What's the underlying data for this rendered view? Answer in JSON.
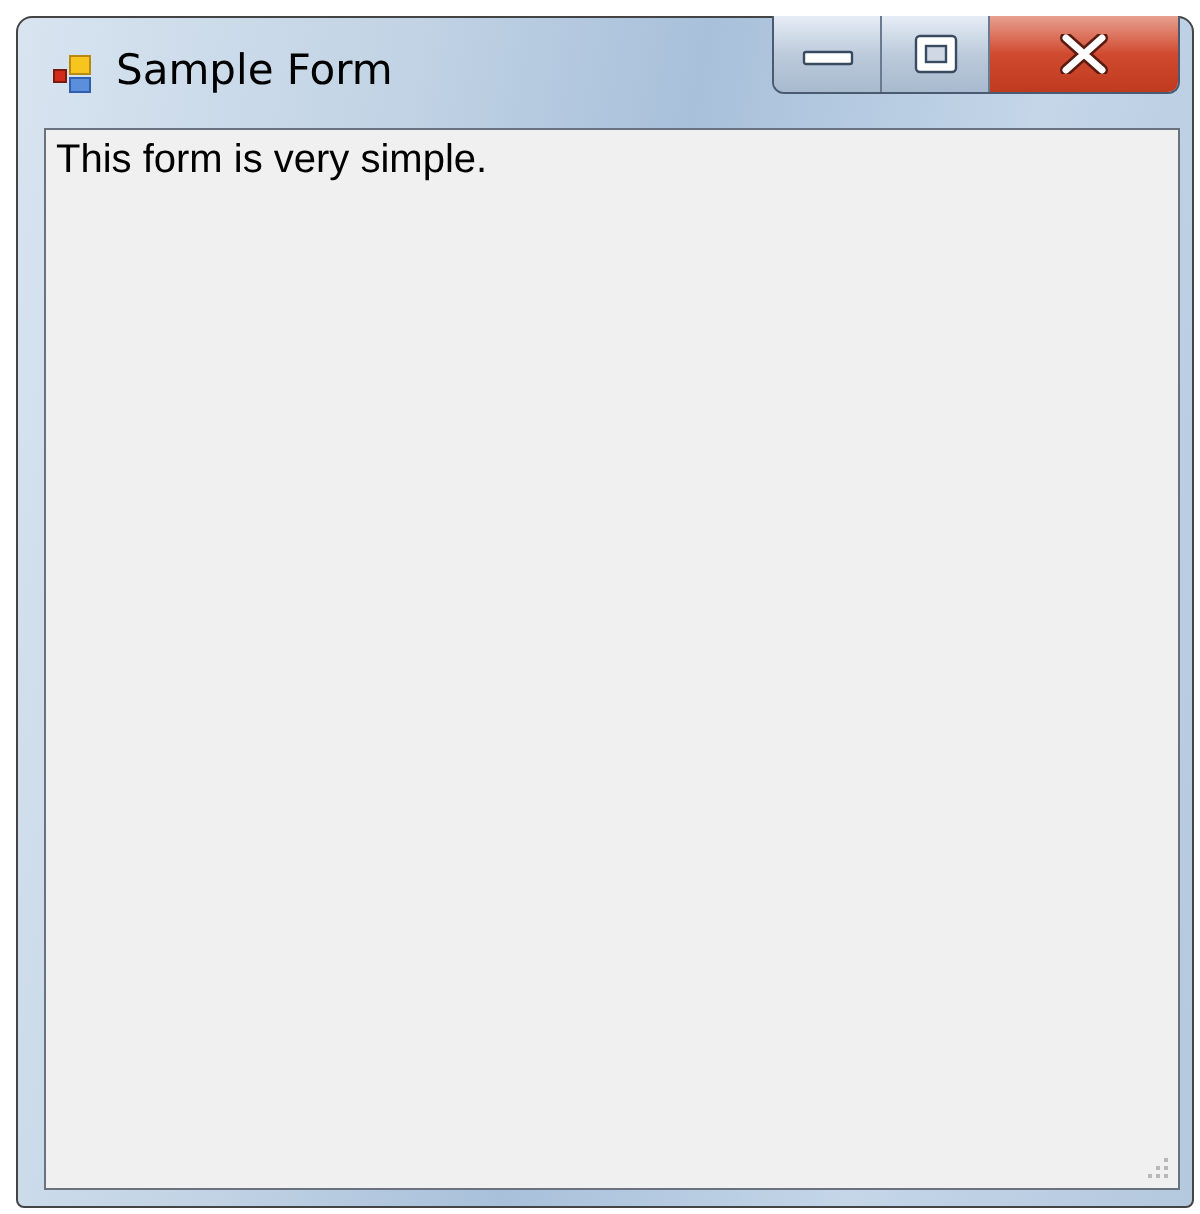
{
  "window": {
    "title": "Sample Form"
  },
  "content": {
    "label": "This form is very simple."
  }
}
